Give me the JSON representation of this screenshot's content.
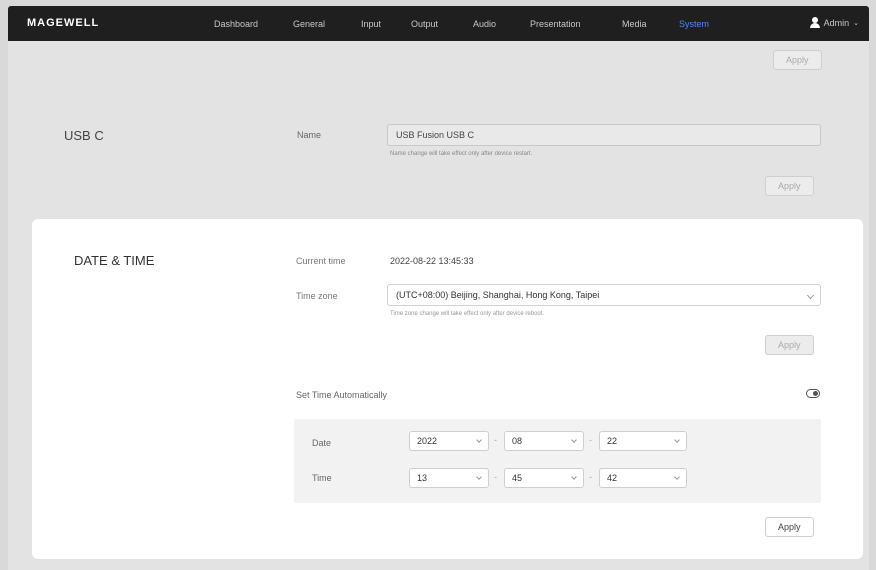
{
  "header": {
    "logo": "MAGEWELL",
    "nav": [
      {
        "label": "Dashboard",
        "active": false
      },
      {
        "label": "General",
        "active": false
      },
      {
        "label": "Input",
        "active": false
      },
      {
        "label": "Output",
        "active": false
      },
      {
        "label": "Audio",
        "active": false
      },
      {
        "label": "Presentation",
        "active": false
      },
      {
        "label": "Media",
        "active": false
      },
      {
        "label": "System",
        "active": true
      }
    ],
    "user": "Admin"
  },
  "top_apply_label": "Apply",
  "usb": {
    "title": "USB C",
    "name_label": "Name",
    "name_value": "USB Fusion USB C",
    "hint": "Name change will take effect only after device restart.",
    "apply_label": "Apply"
  },
  "datetime": {
    "title": "DATE & TIME",
    "current_time_label": "Current time",
    "current_time_value": "2022-08-22 13:45:33",
    "timezone_label": "Time zone",
    "timezone_value": "(UTC+08:00) Beijing, Shanghai, Hong Kong, Taipei",
    "timezone_hint": "Time zone change will take effect only after device reboot.",
    "timezone_apply_label": "Apply",
    "auto_label": "Set Time Automatically",
    "auto_enabled": false,
    "date_label": "Date",
    "date_year": "2022",
    "date_month": "08",
    "date_day": "22",
    "time_label": "Time",
    "time_hour": "13",
    "time_minute": "45",
    "time_second": "42",
    "sep": "-",
    "apply_label": "Apply"
  },
  "colors": {
    "nav_bg": "#1f1f1f",
    "accent": "#4a8df5",
    "page_bg": "#e3e3e3",
    "card_bg": "#ffffff"
  }
}
